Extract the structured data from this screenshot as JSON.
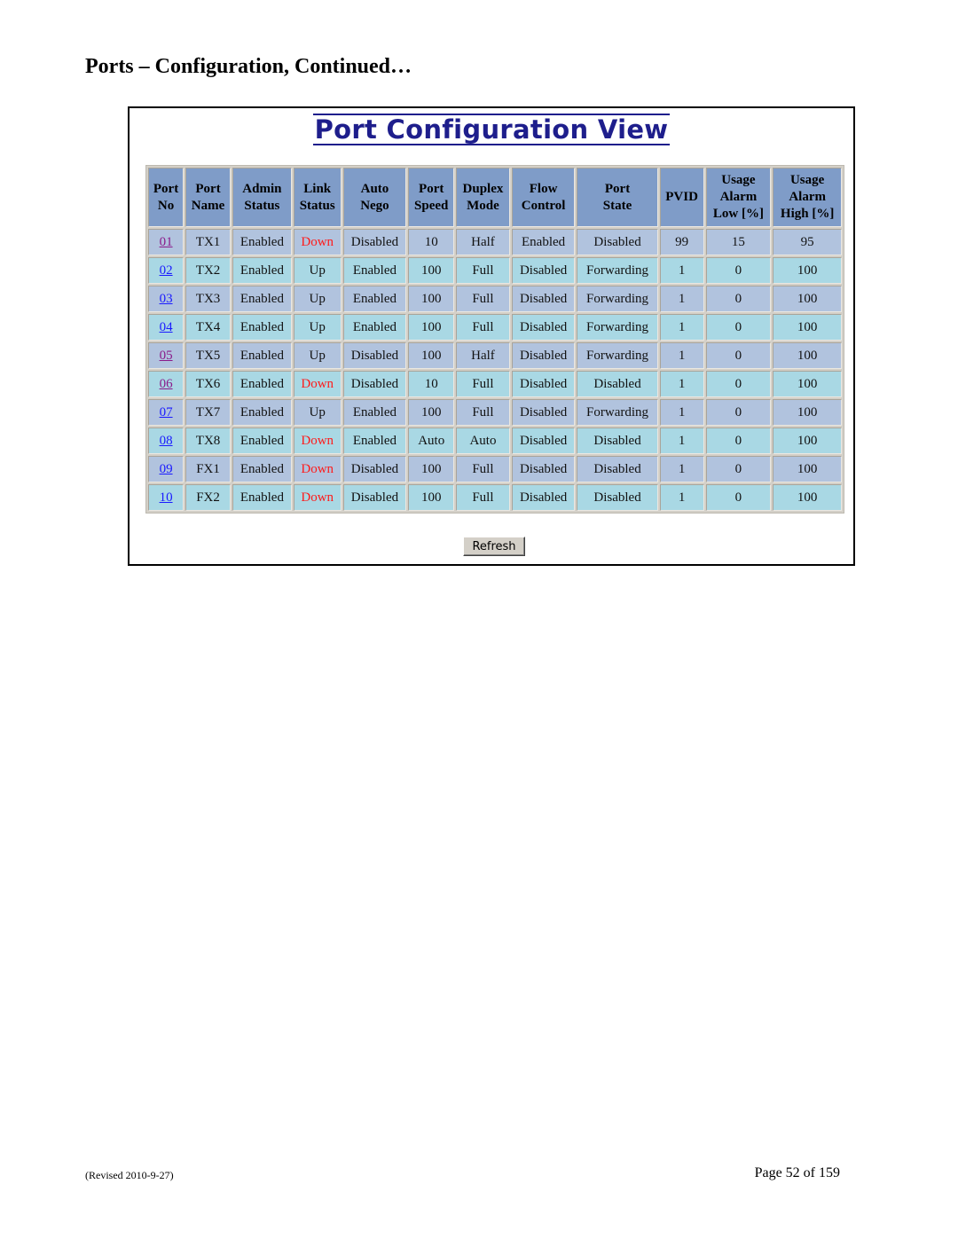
{
  "page": {
    "heading": "Ports – Configuration, Continued…",
    "footer_revised": "(Revised 2010-9-27)",
    "footer_page": "Page 52 of 159"
  },
  "view": {
    "title": "Port Configuration View",
    "title_color": "#1e1e8c",
    "refresh_label": "Refresh"
  },
  "colors": {
    "header_bg": "#7f9cc8",
    "row_odd_bg": "#b1c3de",
    "row_even_bg": "#a9d8e4",
    "link_down": "#ff1a1a",
    "link_unvisited": "#1a1aff",
    "link_visited": "#8a1a8a"
  },
  "table": {
    "headers": [
      [
        "Port",
        "No"
      ],
      [
        "Port",
        "Name"
      ],
      [
        "Admin",
        "Status"
      ],
      [
        "Link",
        "Status"
      ],
      [
        "Auto",
        "Nego"
      ],
      [
        "Port",
        "Speed"
      ],
      [
        "Duplex",
        "Mode"
      ],
      [
        "Flow",
        "Control"
      ],
      [
        "Port",
        "State"
      ],
      [
        "PVID"
      ],
      [
        "Usage",
        "Alarm",
        "Low [%]"
      ],
      [
        "Usage",
        "Alarm",
        "High [%]"
      ]
    ],
    "rows": [
      {
        "port_no": "01",
        "visited": true,
        "port_name": "TX1",
        "admin_status": "Enabled",
        "link_status": "Down",
        "auto_nego": "Disabled",
        "port_speed": "10",
        "duplex_mode": "Half",
        "flow_control": "Enabled",
        "port_state": "Disabled",
        "pvid": "99",
        "usage_alarm_low": "15",
        "usage_alarm_high": "95"
      },
      {
        "port_no": "02",
        "visited": false,
        "port_name": "TX2",
        "admin_status": "Enabled",
        "link_status": "Up",
        "auto_nego": "Enabled",
        "port_speed": "100",
        "duplex_mode": "Full",
        "flow_control": "Disabled",
        "port_state": "Forwarding",
        "pvid": "1",
        "usage_alarm_low": "0",
        "usage_alarm_high": "100"
      },
      {
        "port_no": "03",
        "visited": false,
        "port_name": "TX3",
        "admin_status": "Enabled",
        "link_status": "Up",
        "auto_nego": "Enabled",
        "port_speed": "100",
        "duplex_mode": "Full",
        "flow_control": "Disabled",
        "port_state": "Forwarding",
        "pvid": "1",
        "usage_alarm_low": "0",
        "usage_alarm_high": "100"
      },
      {
        "port_no": "04",
        "visited": false,
        "port_name": "TX4",
        "admin_status": "Enabled",
        "link_status": "Up",
        "auto_nego": "Enabled",
        "port_speed": "100",
        "duplex_mode": "Full",
        "flow_control": "Disabled",
        "port_state": "Forwarding",
        "pvid": "1",
        "usage_alarm_low": "0",
        "usage_alarm_high": "100"
      },
      {
        "port_no": "05",
        "visited": true,
        "port_name": "TX5",
        "admin_status": "Enabled",
        "link_status": "Up",
        "auto_nego": "Disabled",
        "port_speed": "100",
        "duplex_mode": "Half",
        "flow_control": "Disabled",
        "port_state": "Forwarding",
        "pvid": "1",
        "usage_alarm_low": "0",
        "usage_alarm_high": "100"
      },
      {
        "port_no": "06",
        "visited": true,
        "port_name": "TX6",
        "admin_status": "Enabled",
        "link_status": "Down",
        "auto_nego": "Disabled",
        "port_speed": "10",
        "duplex_mode": "Full",
        "flow_control": "Disabled",
        "port_state": "Disabled",
        "pvid": "1",
        "usage_alarm_low": "0",
        "usage_alarm_high": "100"
      },
      {
        "port_no": "07",
        "visited": false,
        "port_name": "TX7",
        "admin_status": "Enabled",
        "link_status": "Up",
        "auto_nego": "Enabled",
        "port_speed": "100",
        "duplex_mode": "Full",
        "flow_control": "Disabled",
        "port_state": "Forwarding",
        "pvid": "1",
        "usage_alarm_low": "0",
        "usage_alarm_high": "100"
      },
      {
        "port_no": "08",
        "visited": false,
        "port_name": "TX8",
        "admin_status": "Enabled",
        "link_status": "Down",
        "auto_nego": "Enabled",
        "port_speed": "Auto",
        "duplex_mode": "Auto",
        "flow_control": "Disabled",
        "port_state": "Disabled",
        "pvid": "1",
        "usage_alarm_low": "0",
        "usage_alarm_high": "100"
      },
      {
        "port_no": "09",
        "visited": false,
        "port_name": "FX1",
        "admin_status": "Enabled",
        "link_status": "Down",
        "auto_nego": "Disabled",
        "port_speed": "100",
        "duplex_mode": "Full",
        "flow_control": "Disabled",
        "port_state": "Disabled",
        "pvid": "1",
        "usage_alarm_low": "0",
        "usage_alarm_high": "100"
      },
      {
        "port_no": "10",
        "visited": false,
        "port_name": "FX2",
        "admin_status": "Enabled",
        "link_status": "Down",
        "auto_nego": "Disabled",
        "port_speed": "100",
        "duplex_mode": "Full",
        "flow_control": "Disabled",
        "port_state": "Disabled",
        "pvid": "1",
        "usage_alarm_low": "0",
        "usage_alarm_high": "100"
      }
    ]
  }
}
